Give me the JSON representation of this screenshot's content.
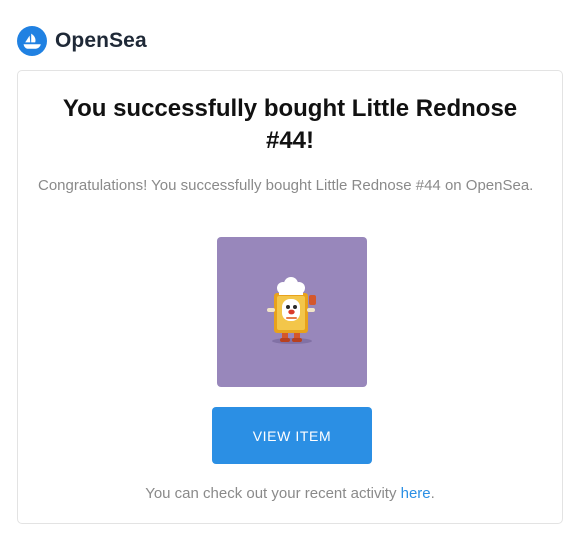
{
  "header": {
    "logo_icon": "opensea-logo-icon",
    "brand_name": "OpenSea",
    "brand_color": "#2081e2"
  },
  "email": {
    "title": "You successfully bought Little Rednose #44!",
    "message": "Congratulations! You successfully bought Little Rednose #44 on OpenSea.",
    "nft_image": {
      "icon": "little-rednose-nft-image",
      "background_color": "#9887bb"
    },
    "cta_label": "VIEW ITEM",
    "cta_color": "#2b8fe4",
    "footer_prefix": "You can check out your recent activity ",
    "footer_link": "here",
    "footer_suffix": "."
  }
}
